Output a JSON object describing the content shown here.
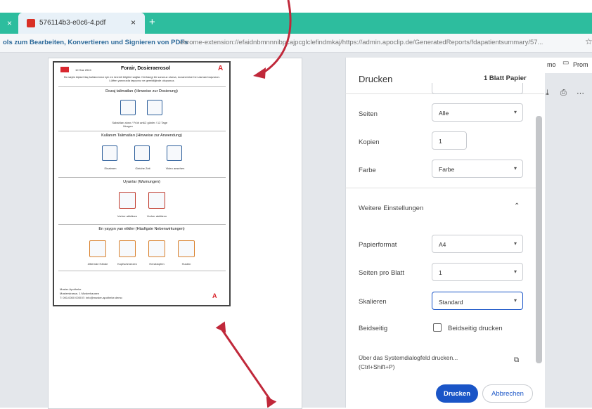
{
  "browser": {
    "tab_title": "576114b3-e0c6-4.pdf",
    "tab_close": "×",
    "left_close": "×",
    "new_tab": "+",
    "extension_text": "ols zum Bearbeiten, Konvertieren und Signieren von PDFs",
    "url": "chrome-extension://efaidnbmnnnibpcajpcglclefindmkaj/https://admin.apoclip.de/GeneratedReports/fdapatientsummary/57...",
    "bookmarks": [
      "mo",
      "Prom"
    ]
  },
  "pdf_preview": {
    "date": "10 Haz 2024",
    "title": "Forair, Dosieraerosol",
    "intro": "Bu sayfa kişisel ilaç kullanımınız için en önemli bilgileri sağlar. Herhangi bir sorunuz olursa, eczanemize her zaman başvurun. Lütfen yanınızda taşıyınız ve gerektiğinde okuyunuz.",
    "section1": "Dozaj talimatları (Hinweise zur Dosierung)",
    "dose_items": [
      {
        "label": "Sabahları alınır / Früh am Morgen"
      },
      {
        "label": "12 günler / 12 Tage"
      }
    ],
    "section2": "Kullanım Talimatları (Hinweise zur Anwendung)",
    "use_items": [
      {
        "label": "Einatmen"
      },
      {
        "label": "Gleiche Zeit"
      },
      {
        "label": "Video ansehen"
      }
    ],
    "section3": "Uyarılar (Warnungen)",
    "warn_items": [
      {
        "label": "Vorher abklären"
      },
      {
        "label": "Vorher abklären"
      }
    ],
    "section4": "En yaygın yan etkiler (Häufigste Nebenwirkungen)",
    "side_items": [
      {
        "label": "Zitternde Hände"
      },
      {
        "label": "Kopfschmerzen"
      },
      {
        "label": "Herzklopfen"
      },
      {
        "label": "Husten"
      }
    ],
    "pharmacy": [
      "Muster-Apotheke",
      "Musterstrasse, 1 Musterhausen",
      "T: 000-0000 0000 E: info@muster-apotheke.demo"
    ]
  },
  "print_dialog": {
    "title": "Drucken",
    "pages_info": "1 Blatt Papier",
    "pages_label": "Seiten",
    "pages_value": "Alle",
    "copies_label": "Kopien",
    "copies_value": "1",
    "color_label": "Farbe",
    "color_value": "Farbe",
    "more_settings": "Weitere Einstellungen",
    "paper_label": "Papierformat",
    "paper_value": "A4",
    "per_sheet_label": "Seiten pro Blatt",
    "per_sheet_value": "1",
    "scale_label": "Skalieren",
    "scale_value": "Standard",
    "duplex_label": "Beidseitig",
    "duplex_checkbox": "Beidseitig drucken",
    "system_dialog_1": "Über das Systemdialogfeld drucken...",
    "system_dialog_2": "(Ctrl+Shift+P)",
    "print_button": "Drucken",
    "cancel_button": "Abbrechen"
  },
  "colors": {
    "tab_bar": "#2dbd9e",
    "primary_button": "#1a55c7",
    "annotation": "#c0283a"
  }
}
